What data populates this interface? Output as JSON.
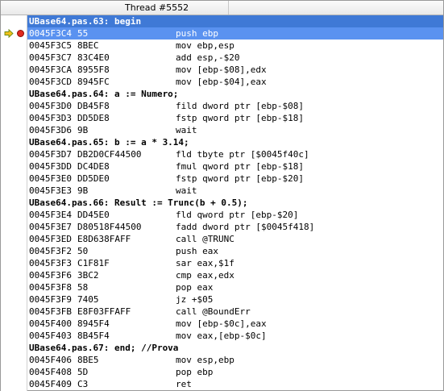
{
  "header": {
    "title": "Thread #5552"
  },
  "colors": {
    "selected_row": "#3f79d6",
    "current_row": "#5a92f0",
    "breakpoint": "#e02a1f",
    "exec_arrow": "#f2c21b"
  },
  "rows": [
    {
      "type": "source",
      "text": "UBase64.pas.63: begin",
      "state": "selected"
    },
    {
      "type": "asm",
      "addr": "0045F3C4",
      "bytes": "55",
      "instr": "push ebp",
      "state": "current",
      "breakpoint": true,
      "exec": true
    },
    {
      "type": "asm",
      "addr": "0045F3C5",
      "bytes": "8BEC",
      "instr": "mov ebp,esp"
    },
    {
      "type": "asm",
      "addr": "0045F3C7",
      "bytes": "83C4E0",
      "instr": "add esp,-$20"
    },
    {
      "type": "asm",
      "addr": "0045F3CA",
      "bytes": "8955F8",
      "instr": "mov [ebp-$08],edx"
    },
    {
      "type": "asm",
      "addr": "0045F3CD",
      "bytes": "8945FC",
      "instr": "mov [ebp-$04],eax"
    },
    {
      "type": "source",
      "text": "UBase64.pas.64: a := Numero;"
    },
    {
      "type": "asm",
      "addr": "0045F3D0",
      "bytes": "DB45F8",
      "instr": "fild dword ptr [ebp-$08]"
    },
    {
      "type": "asm",
      "addr": "0045F3D3",
      "bytes": "DD5DE8",
      "instr": "fstp qword ptr [ebp-$18]"
    },
    {
      "type": "asm",
      "addr": "0045F3D6",
      "bytes": "9B",
      "instr": "wait"
    },
    {
      "type": "source",
      "text": "UBase64.pas.65: b := a * 3.14;"
    },
    {
      "type": "asm",
      "addr": "0045F3D7",
      "bytes": "DB2D0CF44500",
      "instr": "fld tbyte ptr [$0045f40c]"
    },
    {
      "type": "asm",
      "addr": "0045F3DD",
      "bytes": "DC4DE8",
      "instr": "fmul qword ptr [ebp-$18]"
    },
    {
      "type": "asm",
      "addr": "0045F3E0",
      "bytes": "DD5DE0",
      "instr": "fstp qword ptr [ebp-$20]"
    },
    {
      "type": "asm",
      "addr": "0045F3E3",
      "bytes": "9B",
      "instr": "wait"
    },
    {
      "type": "source",
      "text": "UBase64.pas.66: Result := Trunc(b + 0.5);"
    },
    {
      "type": "asm",
      "addr": "0045F3E4",
      "bytes": "DD45E0",
      "instr": "fld qword ptr [ebp-$20]"
    },
    {
      "type": "asm",
      "addr": "0045F3E7",
      "bytes": "D80518F44500",
      "instr": "fadd dword ptr [$0045f418]"
    },
    {
      "type": "asm",
      "addr": "0045F3ED",
      "bytes": "E8D638FAFF",
      "instr": "call @TRUNC"
    },
    {
      "type": "asm",
      "addr": "0045F3F2",
      "bytes": "50",
      "instr": "push eax"
    },
    {
      "type": "asm",
      "addr": "0045F3F3",
      "bytes": "C1F81F",
      "instr": "sar eax,$1f"
    },
    {
      "type": "asm",
      "addr": "0045F3F6",
      "bytes": "3BC2",
      "instr": "cmp eax,edx"
    },
    {
      "type": "asm",
      "addr": "0045F3F8",
      "bytes": "58",
      "instr": "pop eax"
    },
    {
      "type": "asm",
      "addr": "0045F3F9",
      "bytes": "7405",
      "instr": "jz +$05"
    },
    {
      "type": "asm",
      "addr": "0045F3FB",
      "bytes": "E8F03FFAFF",
      "instr": "call @BoundErr"
    },
    {
      "type": "asm",
      "addr": "0045F400",
      "bytes": "8945F4",
      "instr": "mov [ebp-$0c],eax"
    },
    {
      "type": "asm",
      "addr": "0045F403",
      "bytes": "8B45F4",
      "instr": "mov eax,[ebp-$0c]"
    },
    {
      "type": "source",
      "text": "UBase64.pas.67: end; //Prova"
    },
    {
      "type": "asm",
      "addr": "0045F406",
      "bytes": "8BE5",
      "instr": "mov esp,ebp"
    },
    {
      "type": "asm",
      "addr": "0045F408",
      "bytes": "5D",
      "instr": "pop ebp"
    },
    {
      "type": "asm",
      "addr": "0045F409",
      "bytes": "C3",
      "instr": "ret"
    }
  ]
}
